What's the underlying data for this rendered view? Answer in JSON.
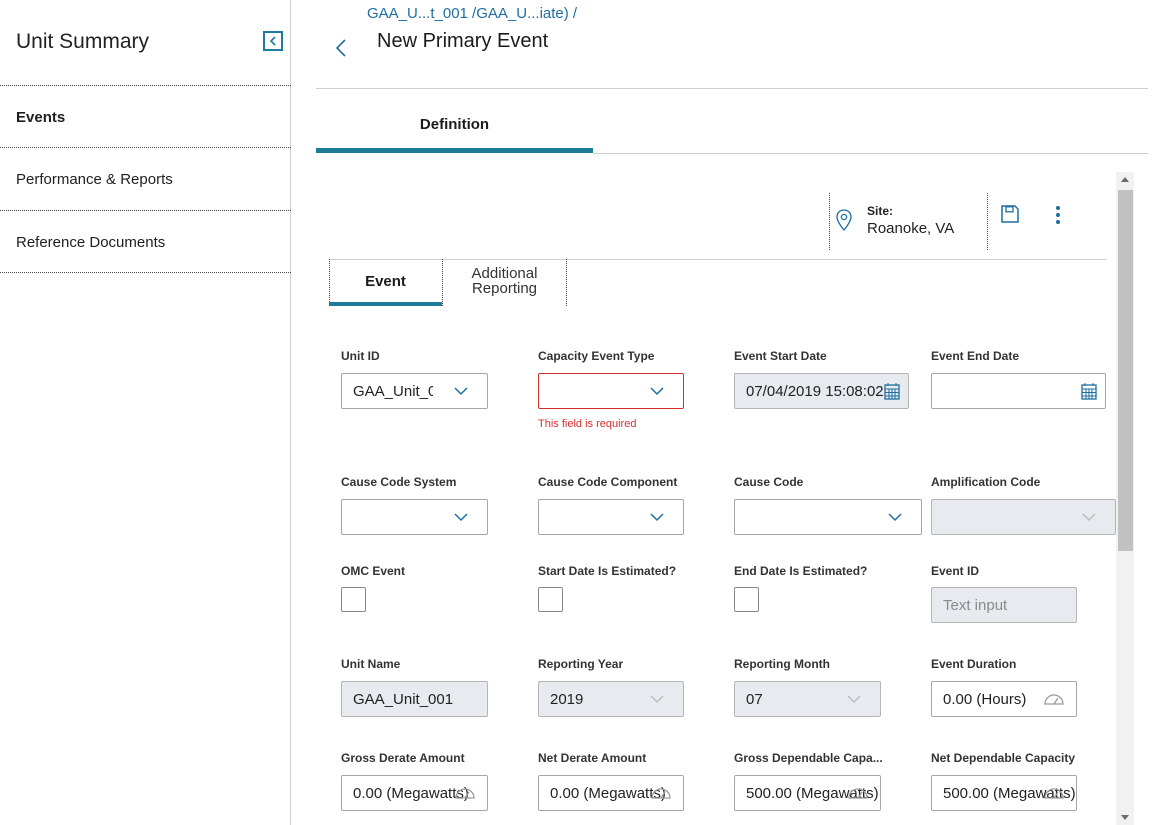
{
  "sidebar": {
    "title": "Unit Summary",
    "items": [
      {
        "label": "Events"
      },
      {
        "label": "Performance & Reports"
      },
      {
        "label": "Reference Documents"
      }
    ]
  },
  "header": {
    "breadcrumb": "GAA_U...t_001 /GAA_U...iate) /",
    "title": "New Primary Event"
  },
  "tabs": {
    "definition": "Definition"
  },
  "site": {
    "label": "Site:",
    "value": "Roanoke, VA"
  },
  "subtabs": {
    "event": "Event",
    "additional": "Additional Reporting"
  },
  "form": {
    "unit_id": {
      "label": "Unit ID",
      "value": "GAA_Unit_0"
    },
    "capacity_event_type": {
      "label": "Capacity Event Type",
      "value": "",
      "error": "This field is required"
    },
    "event_start_date": {
      "label": "Event Start Date",
      "value": "07/04/2019 15:08:02"
    },
    "event_end_date": {
      "label": "Event End Date",
      "value": ""
    },
    "cause_code_system": {
      "label": "Cause Code System",
      "value": ""
    },
    "cause_code_component": {
      "label": "Cause Code Component",
      "value": ""
    },
    "cause_code": {
      "label": "Cause Code",
      "value": ""
    },
    "amplification_code": {
      "label": "Amplification Code",
      "value": ""
    },
    "omc_event": {
      "label": "OMC Event"
    },
    "start_date_estimated": {
      "label": "Start Date Is Estimated?"
    },
    "end_date_estimated": {
      "label": "End Date Is Estimated?"
    },
    "event_id": {
      "label": "Event ID",
      "placeholder": "Text input"
    },
    "unit_name": {
      "label": "Unit Name",
      "value": "GAA_Unit_001"
    },
    "reporting_year": {
      "label": "Reporting Year",
      "value": "2019"
    },
    "reporting_month": {
      "label": "Reporting Month",
      "value": "07"
    },
    "event_duration": {
      "label": "Event Duration",
      "value": "0.00 (Hours)"
    },
    "gross_derate_amount": {
      "label": "Gross Derate Amount",
      "value": "0.00 (Megawatts)"
    },
    "net_derate_amount": {
      "label": "Net Derate Amount",
      "value": "0.00 (Megawatts)"
    },
    "gross_dependable_capacity": {
      "label": "Gross Dependable Capa...",
      "value": "500.00 (Megawatts)"
    },
    "net_dependable_capacity": {
      "label": "Net Dependable Capacity",
      "value": "500.00 (Megawatts)"
    }
  },
  "colors": {
    "accent": "#1d7a98",
    "link": "#1e6ea0",
    "error": "#d32f2f"
  }
}
